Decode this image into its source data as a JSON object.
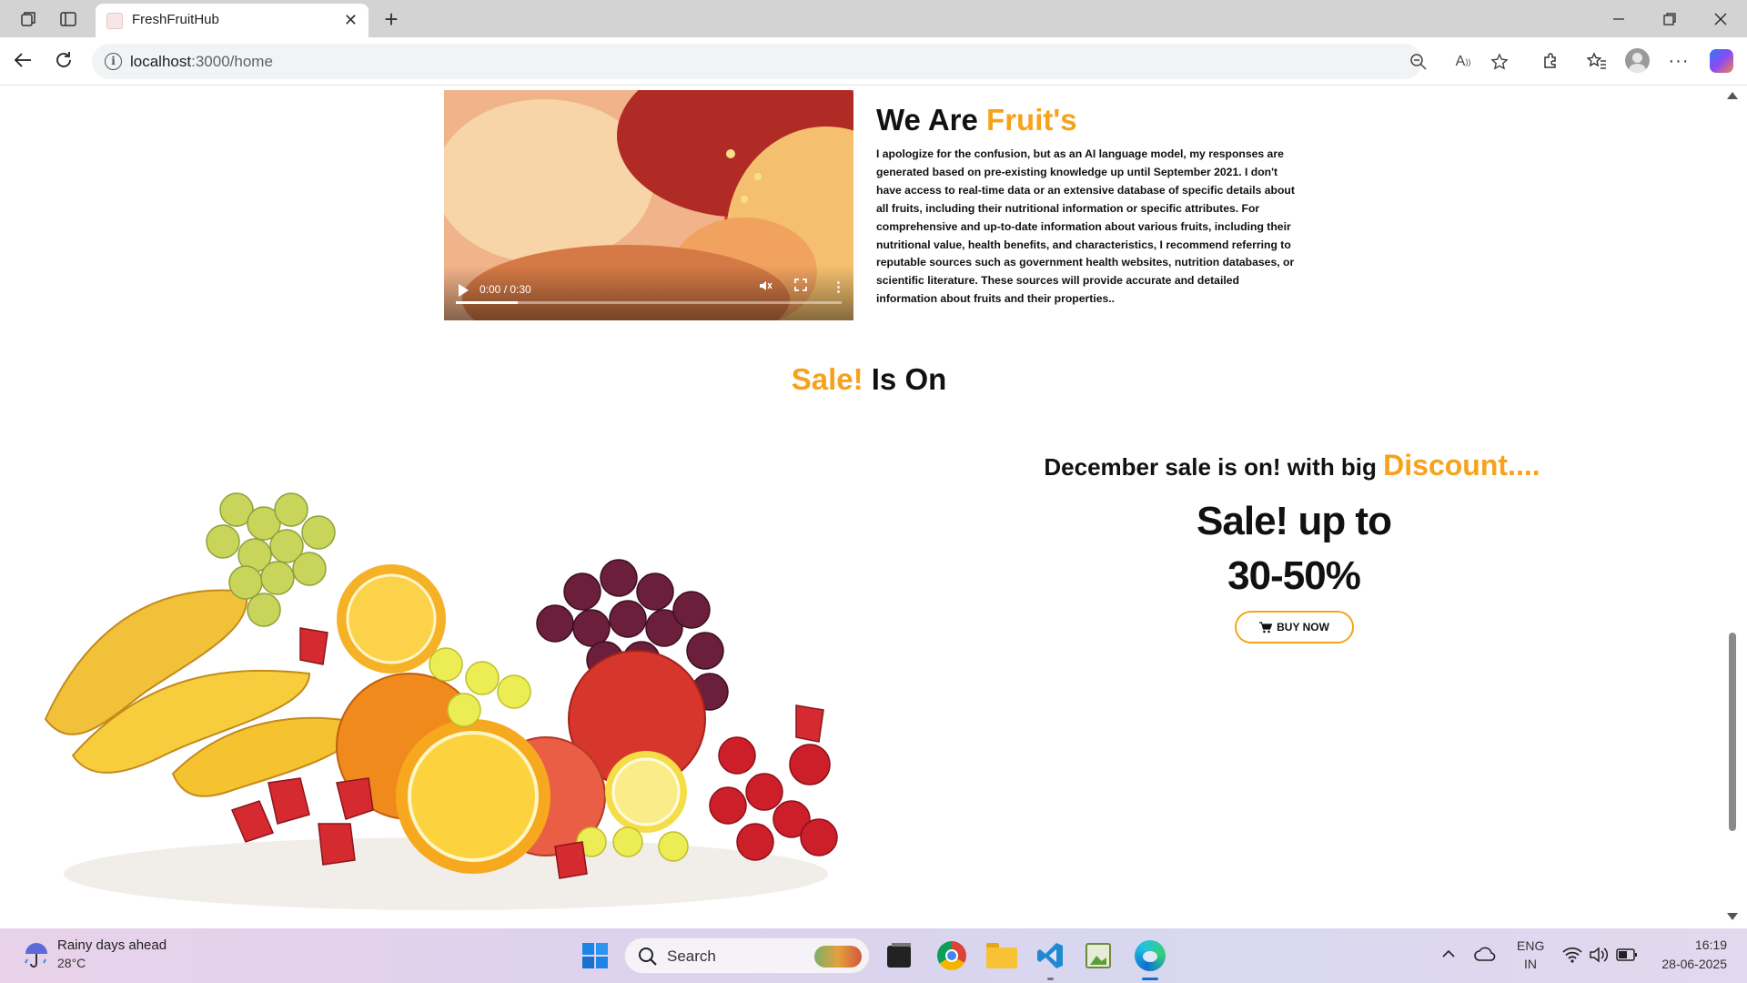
{
  "browser": {
    "tab_title": "FreshFruitHub",
    "url_host": "localhost",
    "url_path": ":3000/home"
  },
  "about": {
    "title_plain": "We Are",
    "title_accent": "Fruit's",
    "paragraph": "I apologize for the confusion, but as an AI language model, my responses are generated based on pre-existing knowledge up until September 2021. I don't have access to real-time data or an extensive database of specific details about all fruits, including their nutritional information or specific attributes. For comprehensive and up-to-date information about various fruits, including their nutritional value, health benefits, and characteristics, I recommend referring to reputable sources such as government health websites, nutrition databases, or scientific literature. These sources will provide accurate and detailed information about fruits and their properties.."
  },
  "video": {
    "time": "0:00 / 0:30",
    "progress": 0.16
  },
  "sale": {
    "heading_accent": "Sale!",
    "heading_plain": "Is On",
    "december_text": "December sale is on! with big",
    "discount_text": "Discount....",
    "line1": "Sale! up to",
    "line2": "30-50%",
    "buy_label": "BUY NOW"
  },
  "taskbar": {
    "weather_title": "Rainy days ahead",
    "weather_temp": "28°C",
    "search_label": "Search",
    "lang_top": "ENG",
    "lang_bottom": "IN",
    "time": "16:19",
    "date": "28-06-2025"
  },
  "colors": {
    "accent": "#f7a21b"
  }
}
